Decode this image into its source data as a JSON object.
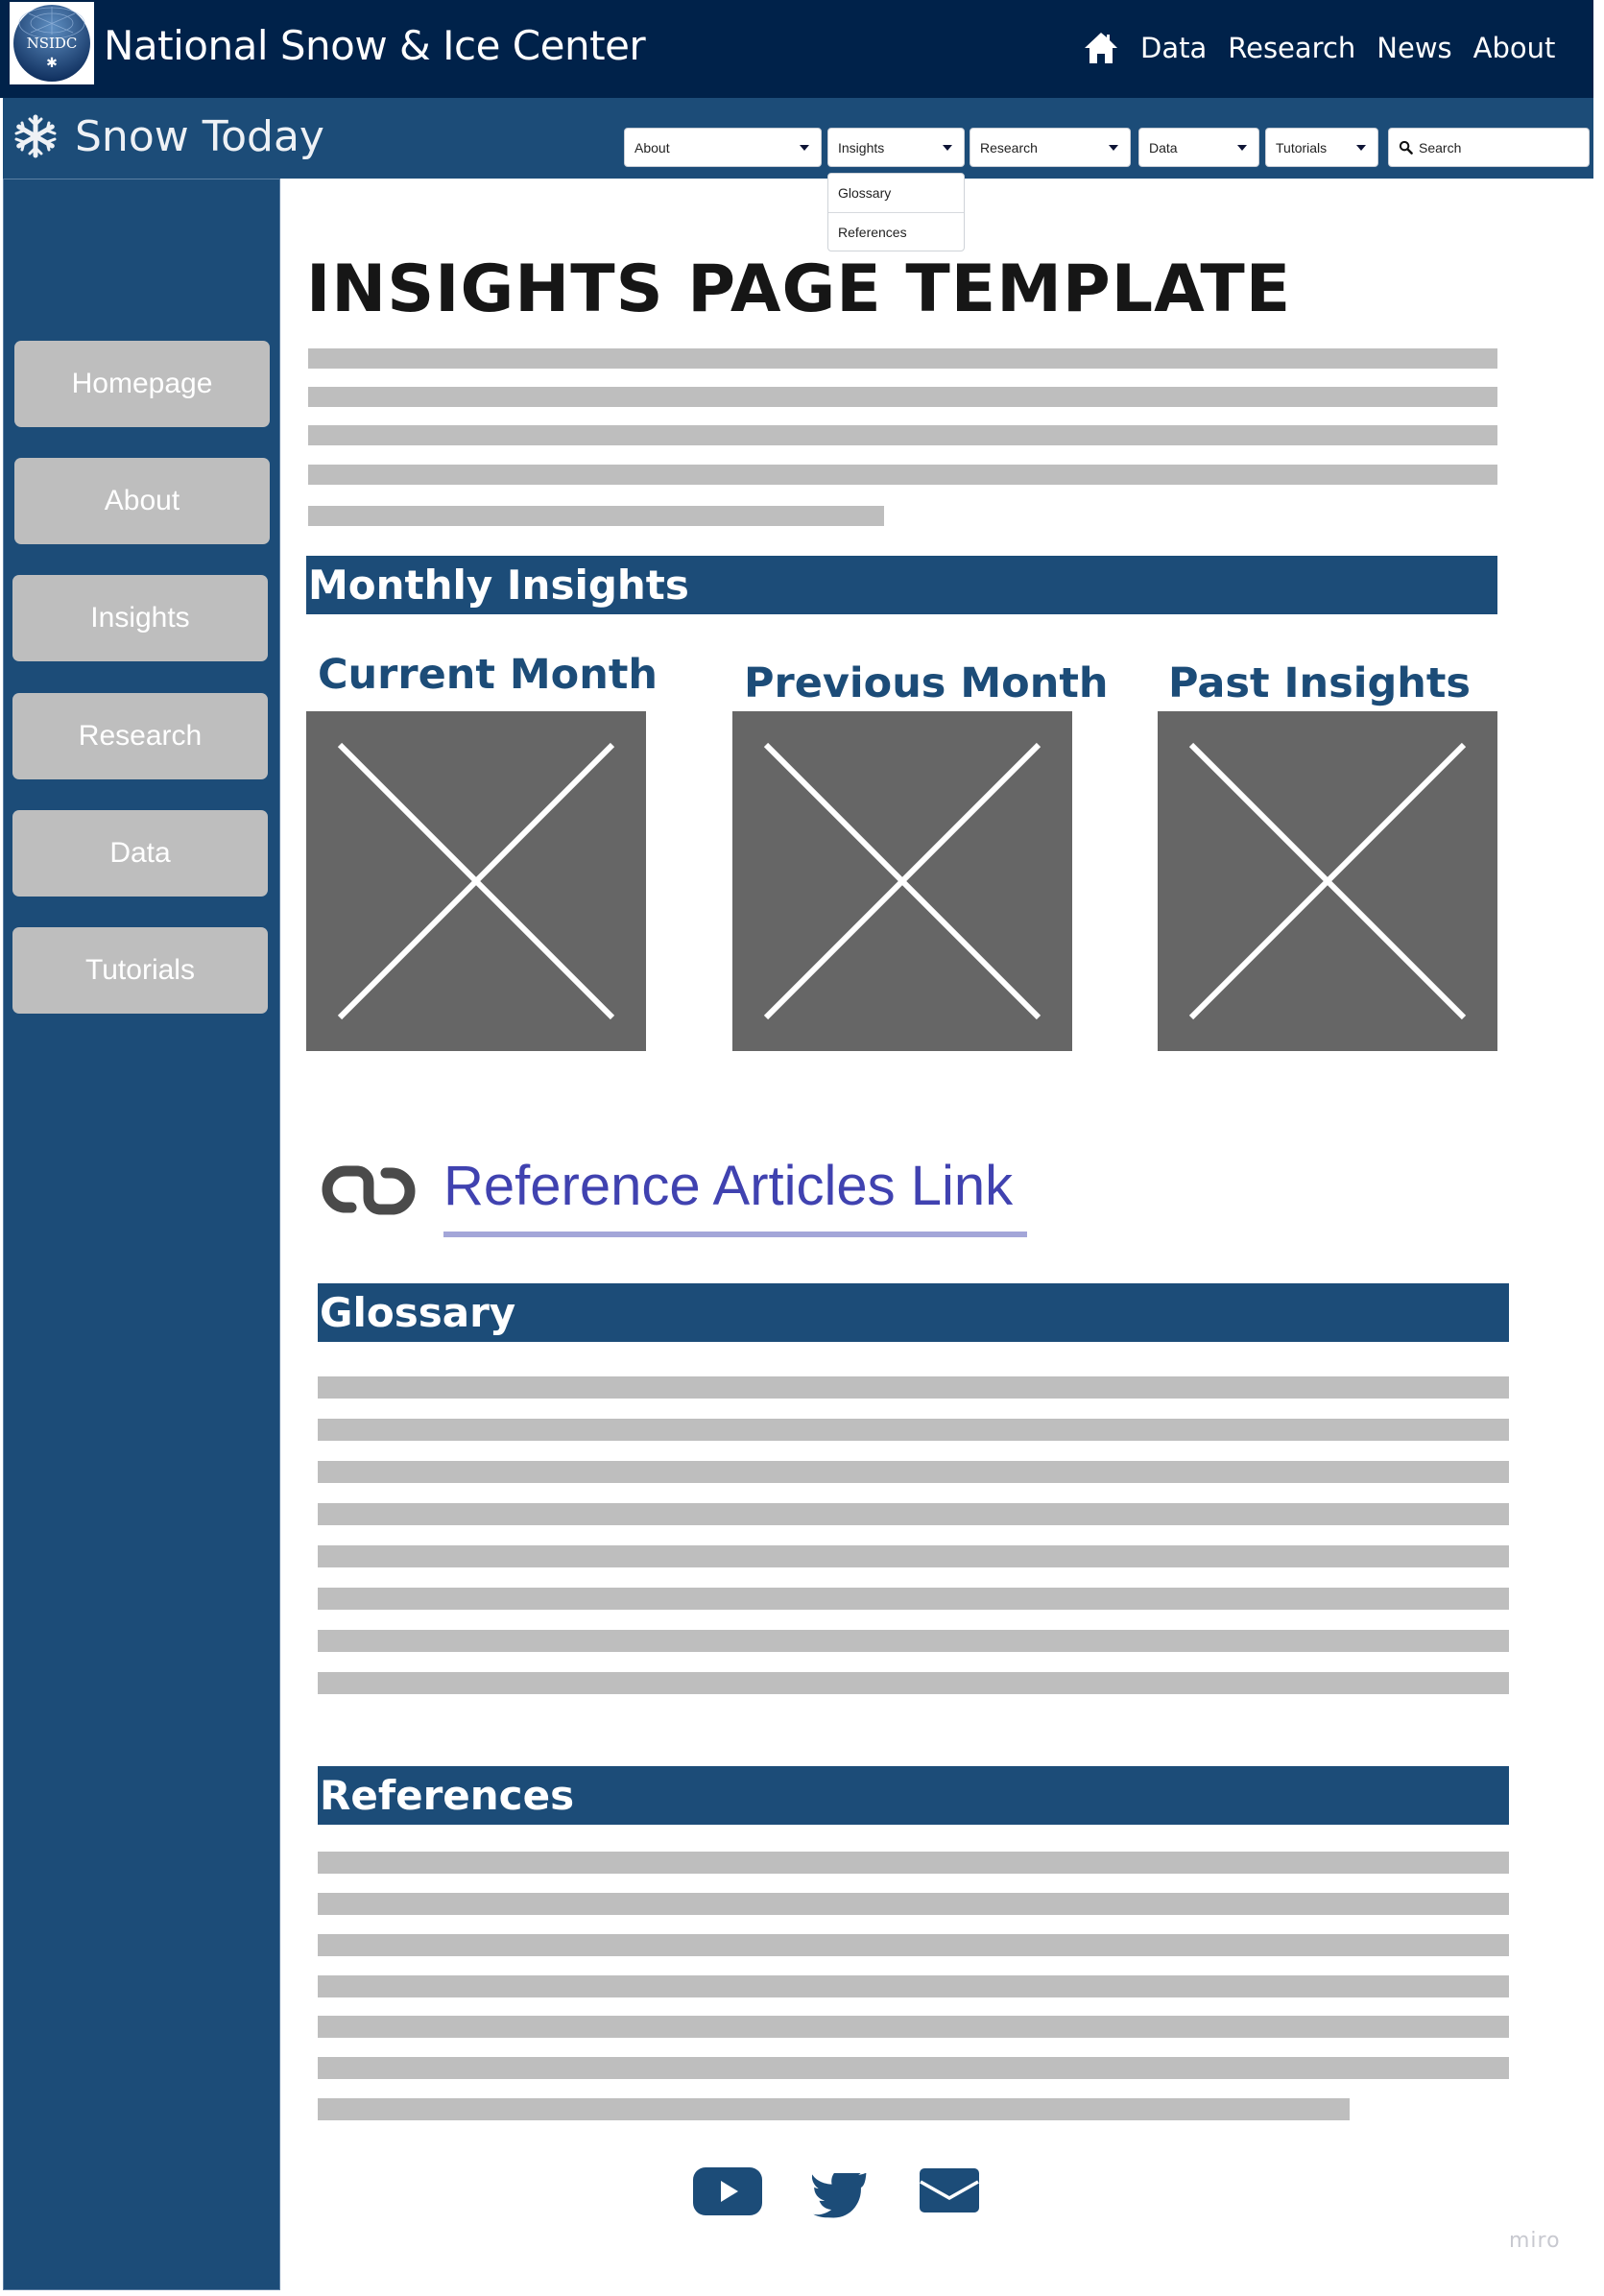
{
  "header": {
    "logo_text": "NSIDC",
    "site_title": "National Snow & Ice Center",
    "top_nav": [
      {
        "label": "Data"
      },
      {
        "label": "Research"
      },
      {
        "label": "News"
      },
      {
        "label": "About"
      }
    ]
  },
  "subheader": {
    "title": "Snow Today",
    "dropdowns": [
      {
        "label": "About"
      },
      {
        "label": "Insights"
      },
      {
        "label": "Research"
      },
      {
        "label": "Data"
      },
      {
        "label": "Tutorials"
      }
    ],
    "search_placeholder": "Search",
    "open_menu": {
      "parent": "Insights",
      "items": [
        {
          "label": "Glossary"
        },
        {
          "label": "References"
        }
      ]
    }
  },
  "sidebar": {
    "items": [
      {
        "label": "Homepage"
      },
      {
        "label": "About"
      },
      {
        "label": "Insights"
      },
      {
        "label": "Research"
      },
      {
        "label": "Data"
      },
      {
        "label": "Tutorials"
      }
    ]
  },
  "main": {
    "page_title": "INSIGHTS PAGE TEMPLATE",
    "monthly_section": {
      "heading": "Monthly Insights",
      "cards": [
        {
          "title": "Current Month"
        },
        {
          "title": "Previous Month"
        },
        {
          "title": "Past Insights"
        }
      ]
    },
    "reference_link": {
      "label": "Reference Articles Link"
    },
    "glossary": {
      "heading": "Glossary"
    },
    "references": {
      "heading": "References"
    }
  },
  "footer": {
    "social": [
      {
        "icon": "youtube-icon"
      },
      {
        "icon": "twitter-icon"
      },
      {
        "icon": "email-icon"
      }
    ]
  },
  "watermark": "miro",
  "colors": {
    "header_dark": "#00224a",
    "brand_blue": "#1c4c78",
    "placeholder_gray": "#bebebe",
    "image_gray": "#666666",
    "link_blue": "#4042b0"
  }
}
